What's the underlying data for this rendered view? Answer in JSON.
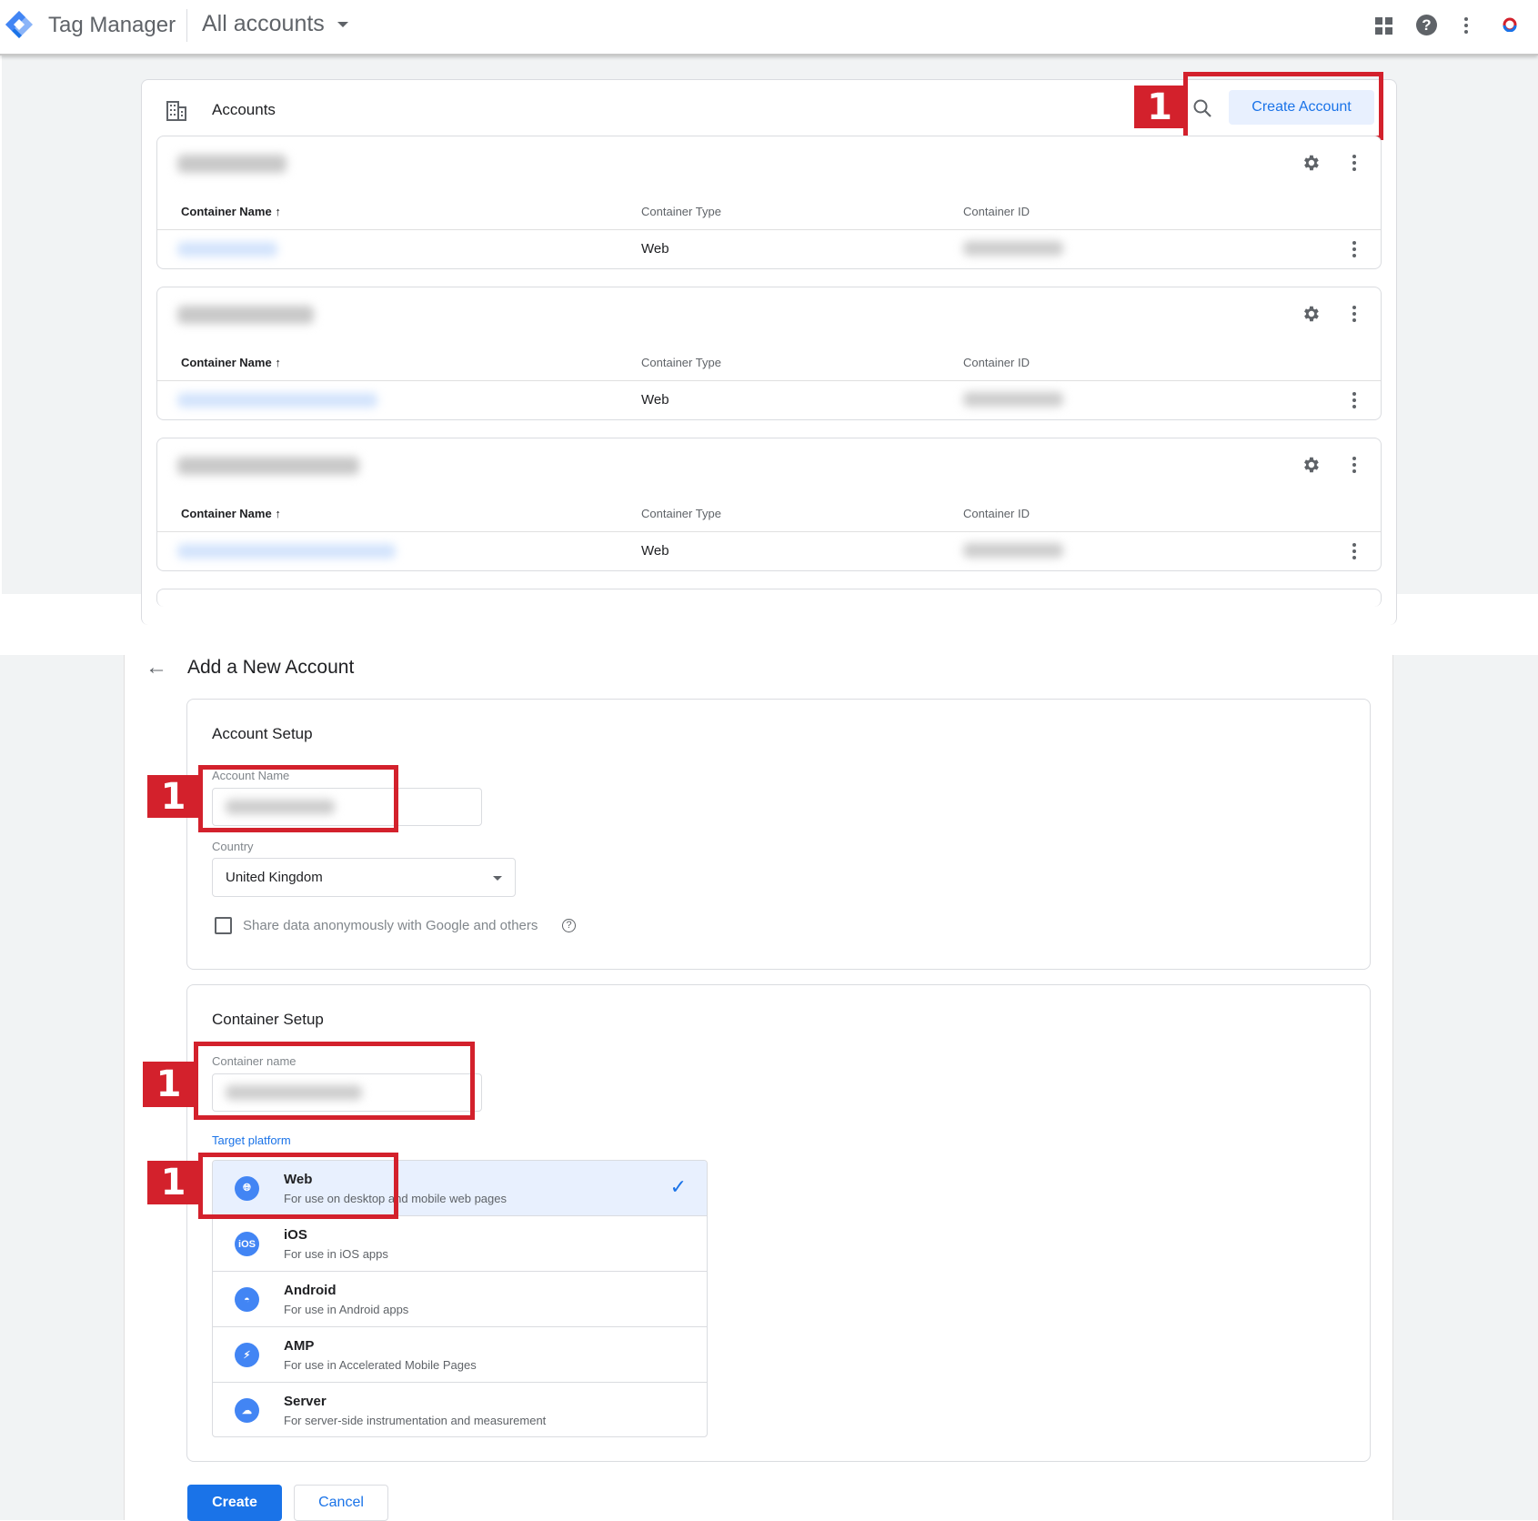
{
  "header": {
    "app_title": "Tag Manager",
    "account_selector": "All accounts",
    "icons": [
      "apps-grid-icon",
      "help-icon",
      "more-vert-icon",
      "account-avatar-icon"
    ]
  },
  "accounts_page": {
    "title": "Accounts",
    "create_button": "Create Account",
    "annotation": "1",
    "accounts": [
      {
        "columns": [
          "Container Name",
          "Container Type",
          "Container ID"
        ],
        "rows": [
          {
            "type": "Web"
          }
        ]
      },
      {
        "columns": [
          "Container Name",
          "Container Type",
          "Container ID"
        ],
        "rows": [
          {
            "type": "Web"
          }
        ]
      },
      {
        "columns": [
          "Container Name",
          "Container Type",
          "Container ID"
        ],
        "rows": [
          {
            "type": "Web"
          }
        ]
      }
    ]
  },
  "new_account": {
    "title": "Add a New Account",
    "account_setup": {
      "heading": "Account Setup",
      "account_name_label": "Account Name",
      "country_label": "Country",
      "country_value": "United Kingdom",
      "share_data_label": "Share data anonymously with Google and others",
      "share_data_checked": false
    },
    "container_setup": {
      "heading": "Container Setup",
      "container_name_label": "Container name",
      "target_platform_label": "Target platform",
      "platforms": [
        {
          "name": "Web",
          "desc": "For use on desktop and mobile web pages",
          "icon": "globe-icon",
          "selected": true
        },
        {
          "name": "iOS",
          "desc": "For use in iOS apps",
          "icon": "ios-icon",
          "selected": false
        },
        {
          "name": "Android",
          "desc": "For use in Android apps",
          "icon": "android-icon",
          "selected": false
        },
        {
          "name": "AMP",
          "desc": "For use in Accelerated Mobile Pages",
          "icon": "amp-bolt-icon",
          "selected": false
        },
        {
          "name": "Server",
          "desc": "For server-side instrumentation and measurement",
          "icon": "cloud-icon",
          "selected": false
        }
      ]
    },
    "create_button": "Create",
    "cancel_button": "Cancel",
    "annotation": "1"
  },
  "colors": {
    "accent": "#1a73e8",
    "annotation_red": "#d3212c",
    "selected_bg": "#e8f0fe"
  }
}
